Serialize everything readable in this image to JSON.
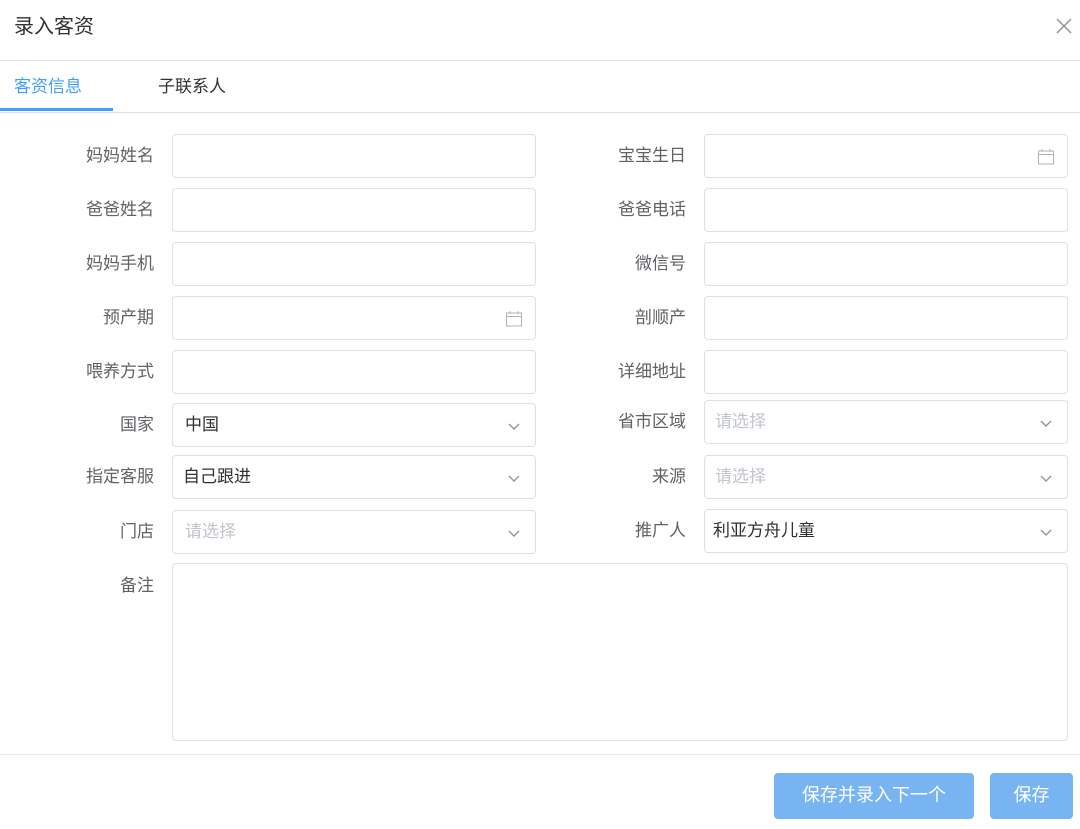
{
  "dialog": {
    "title": "录入客资"
  },
  "tabs": [
    {
      "label": "客资信息",
      "active": true
    },
    {
      "label": "子联系人",
      "active": false
    }
  ],
  "form": {
    "mother_name": {
      "label": "妈妈姓名",
      "value": ""
    },
    "baby_birthday": {
      "label": "宝宝生日",
      "value": ""
    },
    "father_name": {
      "label": "爸爸姓名",
      "value": ""
    },
    "father_phone": {
      "label": "爸爸电话",
      "value": ""
    },
    "mother_mobile": {
      "label": "妈妈手机",
      "value": ""
    },
    "wechat": {
      "label": "微信号",
      "value": ""
    },
    "due_date": {
      "label": "预产期",
      "value": ""
    },
    "delivery_type": {
      "label": "剖顺产",
      "value": ""
    },
    "feeding": {
      "label": "喂养方式",
      "value": ""
    },
    "address": {
      "label": "详细地址",
      "value": ""
    },
    "country": {
      "label": "国家",
      "selected": "中国"
    },
    "region": {
      "label": "省市区域",
      "placeholder": "请选择"
    },
    "service": {
      "label": "指定客服",
      "selected": "自己跟进"
    },
    "source": {
      "label": "来源",
      "placeholder": "请选择"
    },
    "store": {
      "label": "门店",
      "placeholder": "请选择"
    },
    "promoter": {
      "label": "推广人",
      "selected": "利亚方舟儿童"
    },
    "remark": {
      "label": "备注",
      "value": ""
    }
  },
  "footer": {
    "save_next_label": "保存并录入下一个",
    "save_label": "保存"
  },
  "colors": {
    "accent": "#409eff",
    "button": "#79b4f2",
    "border": "#dcdfe6",
    "placeholder": "#c0c4cc"
  },
  "icons": {
    "close": "close-icon",
    "calendar": "calendar-icon",
    "dropdown": "chevron-down-icon"
  }
}
